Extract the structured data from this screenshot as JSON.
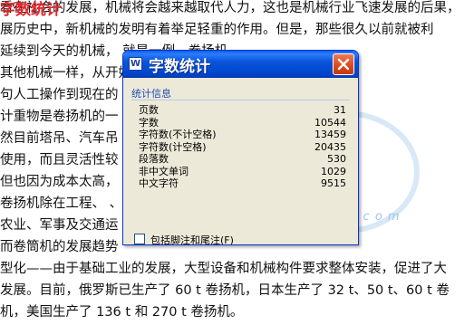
{
  "document": {
    "title": "字数统计",
    "lines": [
      "看在社会的发展，机械将会越来越取代人力，这也是机械行业飞速发展的后果，",
      "展历史中，新机械的发明有着举足轻重的作用。但是，那些很久以前就被利",
      "延续到今天的机械，                                           就是一例。卷扬机",
      "其他机械一样，从开始                                       动力到现在的电力",
      "句人工操作到现在的",
      "计重物是卷扬机的一                                             那是根据这一要求为",
      "然目前塔吊、汽车吊                                           吊成本高，一般在",
      "使用，而且灵活性较                                           卷扬机，汽车吊虽然",
      "但也因为成本太高，                                           的安装仍然是由卷",
      "  卷扬机除在工程、                                            、矿山、建筑、化",
      "农业、军事及交通运",
      "而卷筒机的发展趋势",
      "型化——由于基础工业的发展，大型设备和机械构件要求整体安装，促进了大",
      "发展。目前，俄罗斯已生产了 60 t 卷扬机，日本生产了 32 t、50 t、60 t 卷",
      "机，美国生产了 136 t 和 270 t 卷扬机。"
    ],
    "watermark_url": "w w w . r e n d o c . c o m"
  },
  "dialog": {
    "title": "字数统计",
    "icon": "word-doc-icon",
    "group_label": "统计信息",
    "stats": [
      {
        "label": "页数",
        "value": "31"
      },
      {
        "label": "字数",
        "value": "10544"
      },
      {
        "label": "字符数(不计空格)",
        "value": "13459"
      },
      {
        "label": "字符数(计空格)",
        "value": "20435"
      },
      {
        "label": "段落数",
        "value": "530"
      },
      {
        "label": "非中文单词",
        "value": "1029"
      },
      {
        "label": "中文字符",
        "value": "9515"
      }
    ],
    "checkbox_label": "包括脚注和尾注(F)",
    "checkbox_checked": false,
    "close_button": "关闭"
  },
  "colors": {
    "titlebar": "#0a55d9",
    "close_red": "#d9461c",
    "doc_title": "#e0282e",
    "dialog_bg": "#ece9d8",
    "group_label": "#1f4fb0"
  }
}
